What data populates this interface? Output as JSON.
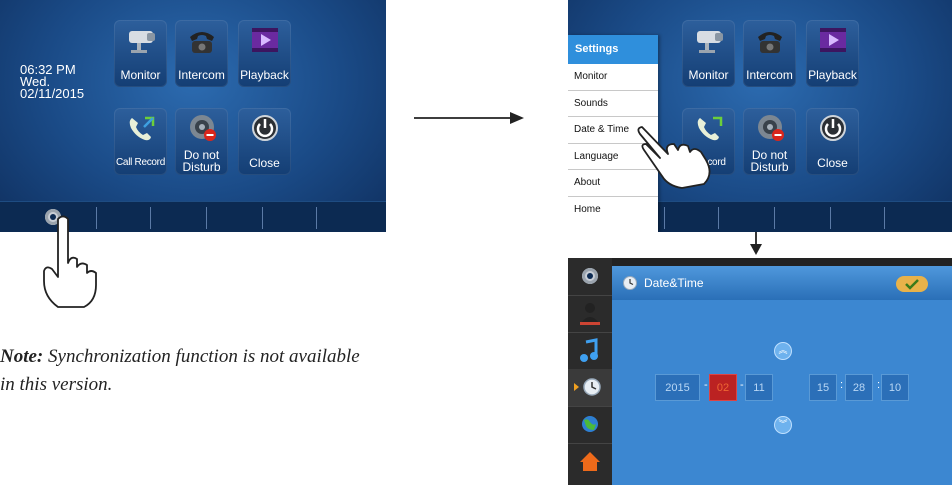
{
  "screen1": {
    "time": "06:32 PM",
    "day": "Wed.",
    "date": "02/11/2015",
    "tiles": [
      {
        "label": "Monitor",
        "icon": "camera-icon"
      },
      {
        "label": "Intercom",
        "icon": "phone-icon"
      },
      {
        "label": "Playback",
        "icon": "playback-icon"
      },
      {
        "label": "Call Record",
        "icon": "call-record-icon"
      },
      {
        "label": "Do not Disturb",
        "line1": "Do not",
        "line2": "Disturb",
        "icon": "do-not-disturb-icon"
      },
      {
        "label": "Close",
        "icon": "power-icon"
      }
    ]
  },
  "screen2": {
    "tiles": [
      {
        "label": "Monitor"
      },
      {
        "label": "Intercom"
      },
      {
        "label": "Playback"
      },
      {
        "label": "cord"
      },
      {
        "line1": "Do not",
        "line2": "Disturb"
      },
      {
        "label": "Close"
      }
    ],
    "menu": {
      "title": "Settings",
      "items": [
        "Monitor",
        "Sounds",
        "Date & Time",
        "Language",
        "About",
        "Home"
      ]
    }
  },
  "screen3": {
    "title": "Date&Time",
    "year": "2015",
    "month": "02",
    "day": "11",
    "hour": "15",
    "minute": "28",
    "second": "10",
    "date_sep": "-",
    "time_sep": ":"
  },
  "note": {
    "lead": "Note:",
    "text": " Synchronization function is not available",
    "text2": "in this version."
  },
  "colors": {
    "screen_bg": "#1a4a86",
    "menu_header": "#2f8fdc",
    "panel": "#3c87d1",
    "highlight_red": "#b22222",
    "confirm_badge": "#e8b24a"
  }
}
